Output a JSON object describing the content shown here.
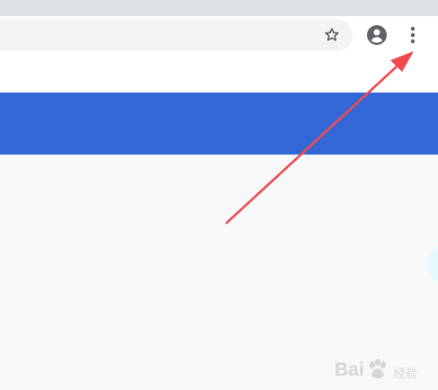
{
  "browser": {
    "address_bar": {
      "value": ""
    },
    "icons": {
      "bookmark": "star-outline-icon",
      "profile": "account-circle-icon",
      "menu": "vertical-dots-menu-icon"
    }
  },
  "page": {
    "header_color": "#3367d6",
    "content_color": "#f7f8fa",
    "bubble_color": "#e6f9fb"
  },
  "annotation": {
    "arrow_color": "#f04a4f"
  },
  "watermark": {
    "brand": "Bai",
    "sub": "经验"
  }
}
